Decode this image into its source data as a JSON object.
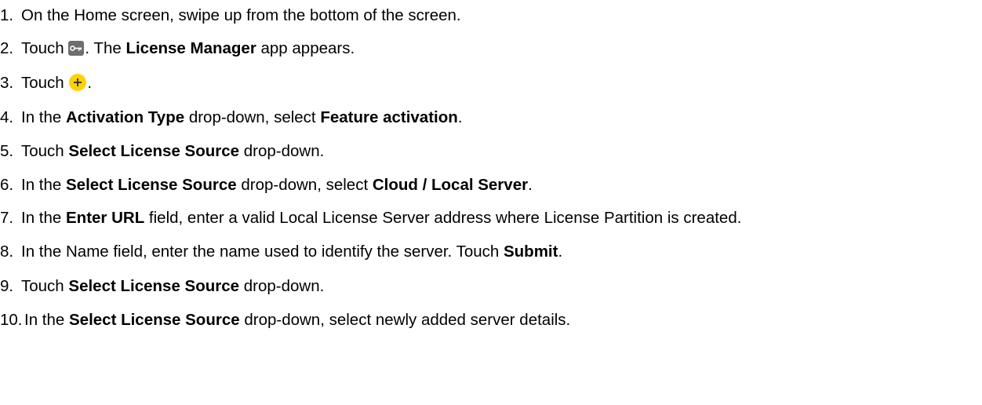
{
  "steps": [
    {
      "num": "1.",
      "parts": [
        {
          "t": "On the Home screen, swipe up from the bottom of the screen."
        }
      ]
    },
    {
      "num": "2.",
      "parts": [
        {
          "t": "Touch "
        },
        {
          "icon": "key-icon"
        },
        {
          "t": ". The "
        },
        {
          "b": "License Manager"
        },
        {
          "t": " app appears."
        }
      ]
    },
    {
      "num": "3.",
      "parts": [
        {
          "t": "Touch "
        },
        {
          "icon": "plus-icon"
        },
        {
          "t": "."
        }
      ]
    },
    {
      "num": "4.",
      "parts": [
        {
          "t": "In the "
        },
        {
          "b": "Activation Type"
        },
        {
          "t": " drop-down, select "
        },
        {
          "b": "Feature activation"
        },
        {
          "t": "."
        }
      ]
    },
    {
      "num": "5.",
      "parts": [
        {
          "t": "Touch "
        },
        {
          "b": "Select License Source"
        },
        {
          "t": " drop-down."
        }
      ]
    },
    {
      "num": "6.",
      "parts": [
        {
          "t": "In the "
        },
        {
          "b": "Select License Source"
        },
        {
          "t": " drop-down, select "
        },
        {
          "b": "Cloud / Local Server"
        },
        {
          "t": "."
        }
      ]
    },
    {
      "num": "7.",
      "parts": [
        {
          "t": "In the "
        },
        {
          "b": "Enter URL"
        },
        {
          "t": " field, enter a valid Local License Server address where License Partition is created."
        }
      ]
    },
    {
      "num": "8.",
      "parts": [
        {
          "t": "In the Name field, enter the name used to identify the server. Touch "
        },
        {
          "b": "Submit"
        },
        {
          "t": "."
        }
      ]
    },
    {
      "num": "9.",
      "parts": [
        {
          "t": "Touch "
        },
        {
          "b": "Select License Source"
        },
        {
          "t": " drop-down."
        }
      ]
    },
    {
      "num": "10.",
      "parts": [
        {
          "t": "In the "
        },
        {
          "b": "Select License Source"
        },
        {
          "t": " drop-down, select newly added server details."
        }
      ]
    }
  ],
  "colors": {
    "text": "#000000",
    "key_icon_bg": "#6e6e6e",
    "plus_icon_bg": "#ffd100"
  }
}
